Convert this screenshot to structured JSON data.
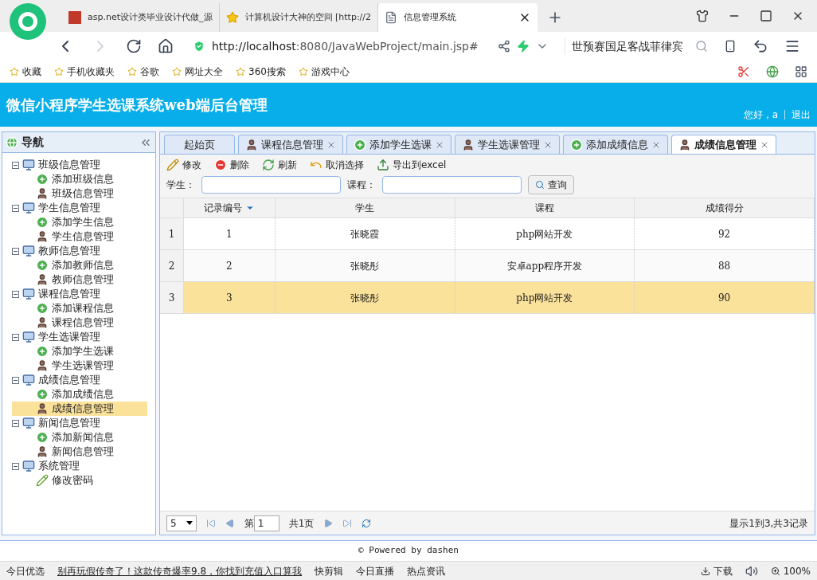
{
  "browser": {
    "tabs": [
      {
        "title": "asp.net设计类毕业设计代做_源",
        "selected": false,
        "kind": "site"
      },
      {
        "title": "计算机设计大神的空间 [http://2",
        "selected": false,
        "kind": "star"
      },
      {
        "title": "信息管理系统",
        "selected": true,
        "kind": "page"
      }
    ],
    "url_host": "http://localhost",
    "url_rest": ":8080/JavaWebProject/main.jsp#",
    "search_text": "世预赛国足客战菲律宾",
    "bookmarks": [
      "收藏",
      "手机收藏夹",
      "谷歌",
      "网址大全",
      "360搜索",
      "游戏中心"
    ]
  },
  "app": {
    "title": "微信小程序学生选课系统web端后台管理",
    "greeting": "您好，a",
    "logout": "退出",
    "nav": {
      "title": "导航",
      "groups": [
        {
          "label": "班级信息管理",
          "expanded": true,
          "children": [
            {
              "label": "添加班级信息",
              "kind": "add",
              "selected": false
            },
            {
              "label": "班级信息管理",
              "kind": "manage",
              "selected": false
            }
          ]
        },
        {
          "label": "学生信息管理",
          "expanded": true,
          "children": [
            {
              "label": "添加学生信息",
              "kind": "add",
              "selected": false
            },
            {
              "label": "学生信息管理",
              "kind": "manage",
              "selected": false
            }
          ]
        },
        {
          "label": "教师信息管理",
          "expanded": true,
          "children": [
            {
              "label": "添加教师信息",
              "kind": "add",
              "selected": false
            },
            {
              "label": "教师信息管理",
              "kind": "manage",
              "selected": false
            }
          ]
        },
        {
          "label": "课程信息管理",
          "expanded": true,
          "children": [
            {
              "label": "添加课程信息",
              "kind": "add",
              "selected": false
            },
            {
              "label": "课程信息管理",
              "kind": "manage",
              "selected": false
            }
          ]
        },
        {
          "label": "学生选课管理",
          "expanded": true,
          "children": [
            {
              "label": "添加学生选课",
              "kind": "add",
              "selected": false
            },
            {
              "label": "学生选课管理",
              "kind": "manage",
              "selected": false
            }
          ]
        },
        {
          "label": "成绩信息管理",
          "expanded": true,
          "children": [
            {
              "label": "添加成绩信息",
              "kind": "add",
              "selected": false
            },
            {
              "label": "成绩信息管理",
              "kind": "manage",
              "selected": true
            }
          ]
        },
        {
          "label": "新闻信息管理",
          "expanded": true,
          "children": [
            {
              "label": "添加新闻信息",
              "kind": "add",
              "selected": false
            },
            {
              "label": "新闻信息管理",
              "kind": "manage",
              "selected": false
            }
          ]
        },
        {
          "label": "系统管理",
          "expanded": true,
          "children": [
            {
              "label": "修改密码",
              "kind": "edit",
              "selected": false
            }
          ]
        }
      ]
    },
    "tabs": [
      {
        "label": "起始页",
        "kind": "home",
        "selected": false
      },
      {
        "label": "课程信息管理",
        "kind": "manage",
        "selected": false
      },
      {
        "label": "添加学生选课",
        "kind": "add",
        "selected": false
      },
      {
        "label": "学生选课管理",
        "kind": "manage",
        "selected": false
      },
      {
        "label": "添加成绩信息",
        "kind": "add",
        "selected": false
      },
      {
        "label": "成绩信息管理",
        "kind": "manage",
        "selected": true
      }
    ],
    "toolbar": [
      {
        "label": "修改",
        "kind": "edit"
      },
      {
        "label": "删除",
        "kind": "delete"
      },
      {
        "label": "刷新",
        "kind": "refresh"
      },
      {
        "label": "取消选择",
        "kind": "undo"
      },
      {
        "label": "导出到excel",
        "kind": "export"
      }
    ],
    "filters": [
      {
        "label": "学生："
      },
      {
        "label": "课程："
      }
    ],
    "search_button": "查询",
    "table": {
      "columns": [
        "记录编号",
        "学生",
        "课程",
        "成绩得分"
      ],
      "rows": [
        {
          "index": "1",
          "cells": [
            "1",
            "张晓霞",
            "php网站开发",
            "92"
          ],
          "selected": false
        },
        {
          "index": "2",
          "cells": [
            "2",
            "张晓彤",
            "安卓app程序开发",
            "88"
          ],
          "selected": false
        },
        {
          "index": "3",
          "cells": [
            "3",
            "张晓彤",
            "php网站开发",
            "90"
          ],
          "selected": true
        }
      ]
    },
    "pager": {
      "page_size": "5",
      "page_prefix": "第",
      "page": "1",
      "page_total": "共1页",
      "summary": "显示1到3,共3记录"
    },
    "footer": "© Powered by dashen"
  },
  "status_bar": {
    "left": "今日优选",
    "news": "别再玩假传奇了！这款传奇爆率9.8，你找到充值入口算我",
    "items": [
      "快剪辑",
      "今日直播",
      "热点资讯"
    ],
    "download": "下载",
    "zoom": "100%"
  }
}
